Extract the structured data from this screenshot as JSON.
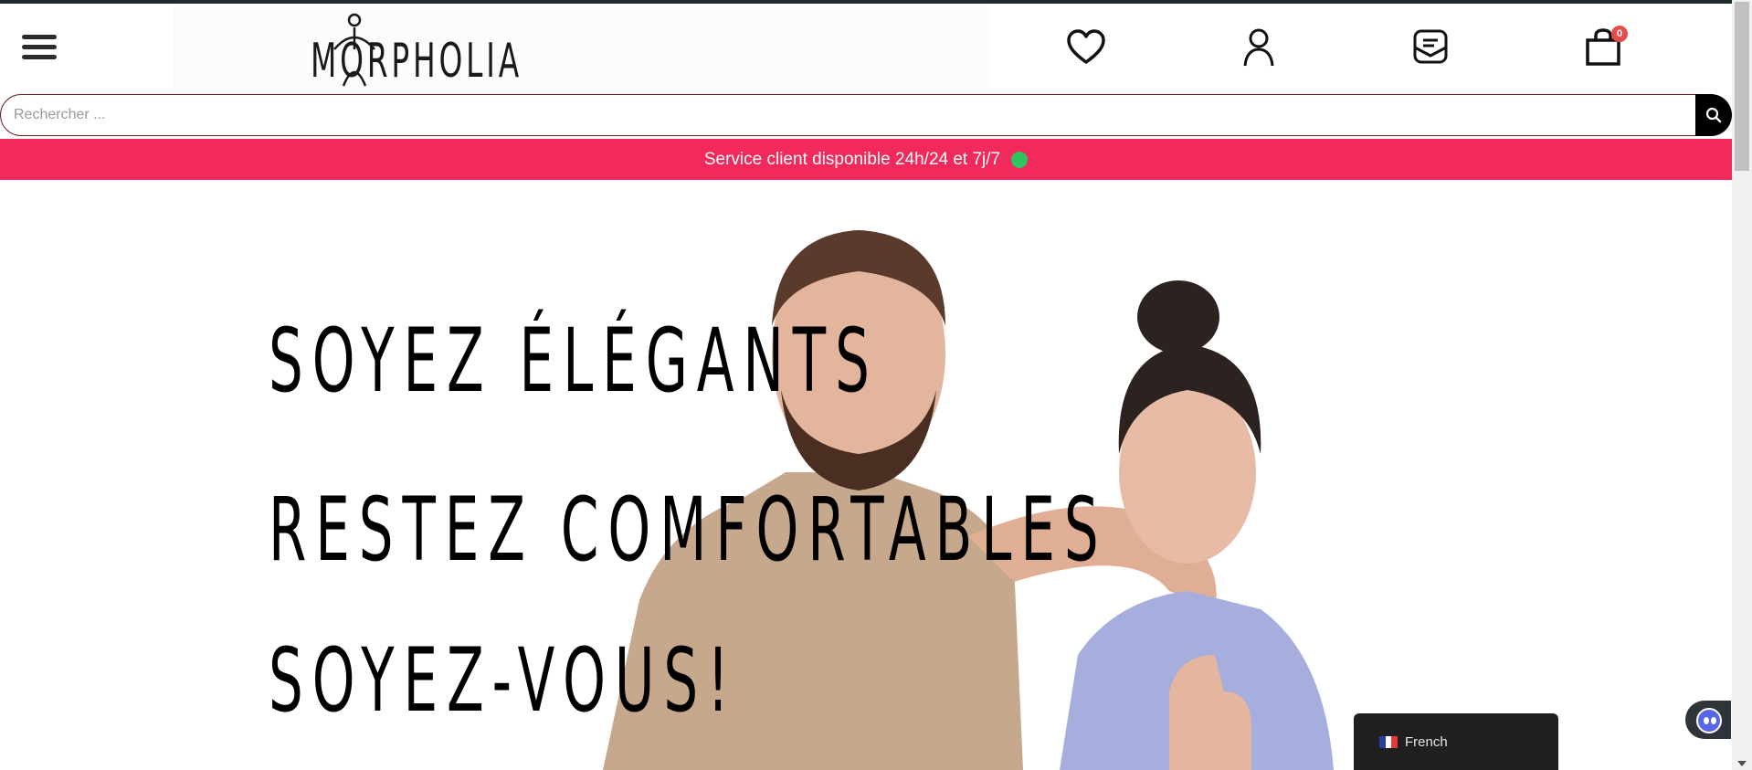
{
  "header": {
    "logo_text": "MORPHOLIA",
    "icons": [
      "menu-icon",
      "heart-icon",
      "user-icon",
      "mail-icon",
      "shopping-bag-icon"
    ],
    "cart_count": "0"
  },
  "search": {
    "placeholder": "Rechercher ...",
    "icon": "search-icon"
  },
  "announcement": {
    "text": "Service client disponible 24h/24 et 7j/7",
    "status_color": "#2ec462"
  },
  "hero": {
    "line1": "SOYEZ ÉLÉGANTS",
    "line2": "RESTEZ COMFORTABLES",
    "line3": "SOYEZ-VOUS!"
  },
  "language": {
    "label": "French",
    "flag": "fr-flag-icon"
  },
  "colors": {
    "accent": "#f2295b",
    "search_border": "#6b2020",
    "badge": "#e84b4b"
  }
}
